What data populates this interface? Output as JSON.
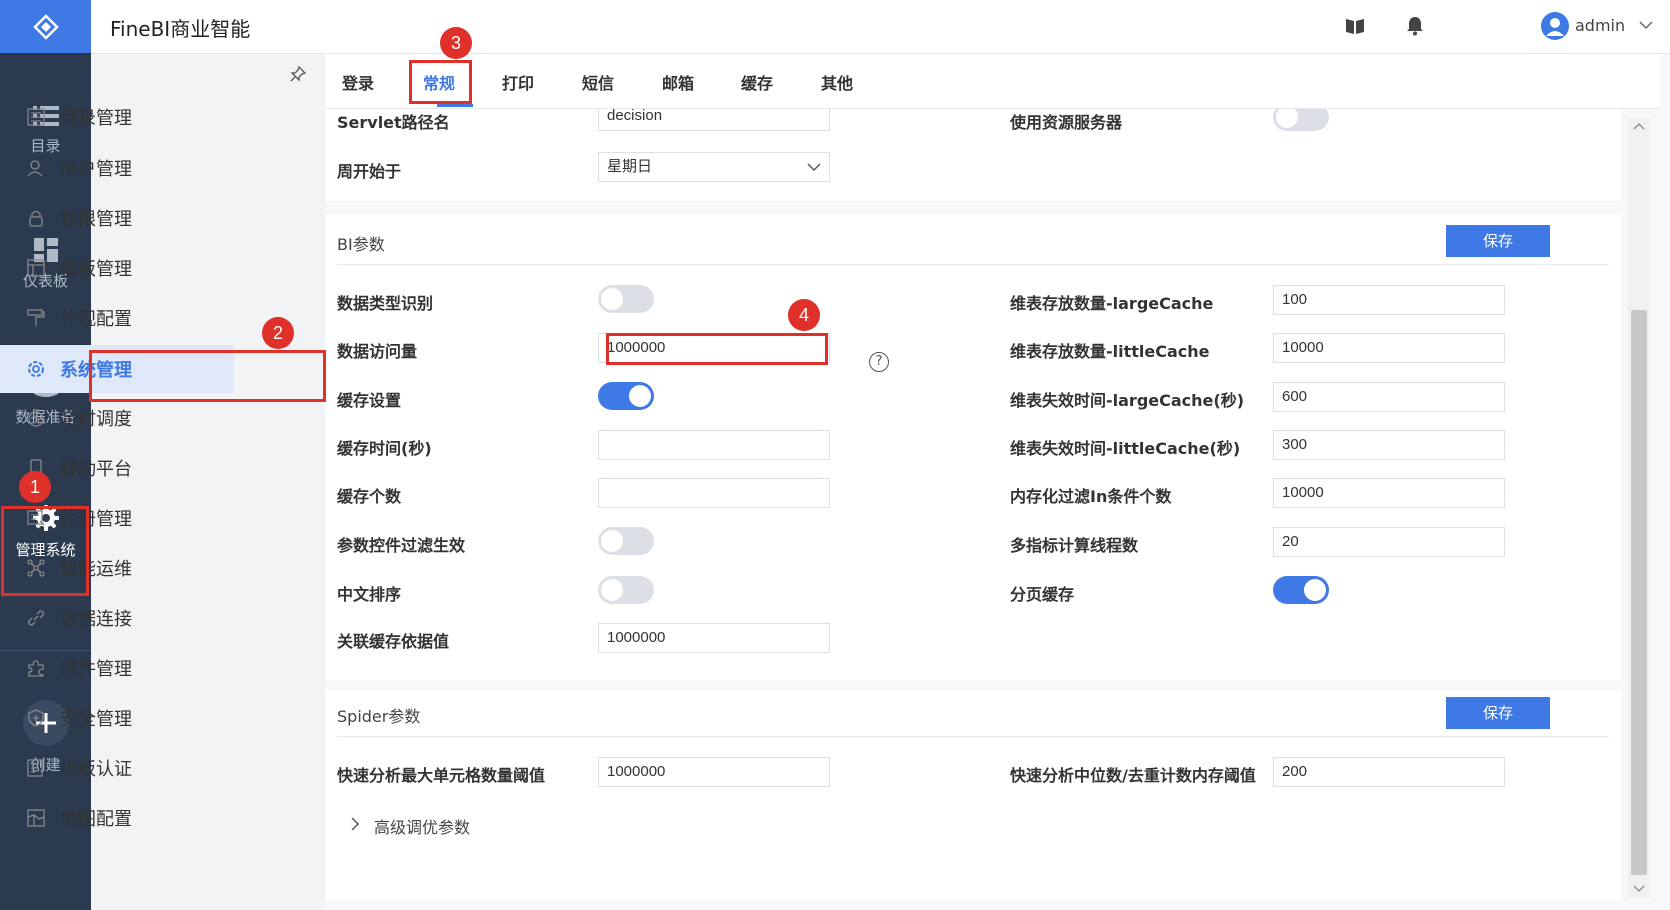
{
  "app": {
    "title": "FineBI商业智能",
    "user": "admin"
  },
  "rail": {
    "items": [
      {
        "label": "目录",
        "icon": "list-icon"
      },
      {
        "label": "仪表板",
        "icon": "dashboard-icon"
      },
      {
        "label": "数据准备",
        "icon": "database-icon"
      },
      {
        "label": "管理系统",
        "icon": "gear-icon"
      },
      {
        "label": "创建",
        "icon": "plus-icon"
      }
    ]
  },
  "sidebar": {
    "items": [
      {
        "label": "目录管理"
      },
      {
        "label": "用户管理"
      },
      {
        "label": "权限管理"
      },
      {
        "label": "模板管理"
      },
      {
        "label": "外观配置"
      },
      {
        "label": "系统管理"
      },
      {
        "label": "定时调度"
      },
      {
        "label": "移动平台"
      },
      {
        "label": "注册管理"
      },
      {
        "label": "智能运维"
      },
      {
        "label": "数据连接"
      },
      {
        "label": "插件管理"
      },
      {
        "label": "安全管理"
      },
      {
        "label": "模板认证"
      },
      {
        "label": "地图配置"
      }
    ],
    "active": "系统管理"
  },
  "tabs": {
    "items": [
      "登录",
      "常规",
      "打印",
      "短信",
      "邮箱",
      "缓存",
      "其他"
    ],
    "active": "常规"
  },
  "top_section": {
    "servlet_label": "Servlet路径名",
    "servlet_value": "decision",
    "resource_label": "使用资源服务器",
    "week_label": "周开始于",
    "week_value": "星期日"
  },
  "bi_params": {
    "title": "BI参数",
    "save": "保存",
    "left": {
      "data_type_label": "数据类型识别",
      "access_label": "数据访问量",
      "access_value": "1000000",
      "cache_setting_label": "缓存设置",
      "cache_time_label": "缓存时间(秒)",
      "cache_time_value": "",
      "cache_count_label": "缓存个数",
      "cache_count_value": "",
      "param_filter_label": "参数控件过滤生效",
      "chinese_sort_label": "中文排序",
      "assoc_cache_label": "关联缓存依据值",
      "assoc_cache_value": "1000000"
    },
    "right": {
      "large_cache_label": "维表存放数量-largeCache",
      "large_cache_value": "100",
      "little_cache_label": "维表存放数量-littleCache",
      "little_cache_value": "10000",
      "large_expire_label": "维表失效时间-largeCache(秒)",
      "large_expire_value": "600",
      "little_expire_label": "维表失效时间-littleCache(秒)",
      "little_expire_value": "300",
      "in_filter_label": "内存化过滤In条件个数",
      "in_filter_value": "10000",
      "multi_thread_label": "多指标计算线程数",
      "multi_thread_value": "20",
      "page_cache_label": "分页缓存"
    },
    "toggles": {
      "data_type": false,
      "cache_setting": true,
      "param_filter": false,
      "chinese_sort": false,
      "page_cache": true,
      "resource_server": false
    }
  },
  "spider_params": {
    "title": "Spider参数",
    "save": "保存",
    "max_cell_label": "快速分析最大单元格数量阈值",
    "max_cell_value": "1000000",
    "median_label": "快速分析中位数/去重计数内存阈值",
    "median_value": "200",
    "advanced_label": "高级调优参数"
  },
  "annotations": [
    "1",
    "2",
    "3",
    "4"
  ],
  "colors": {
    "accent": "#3e79e6",
    "rail": "#2b3a4f",
    "highlight": "#e0302a"
  }
}
